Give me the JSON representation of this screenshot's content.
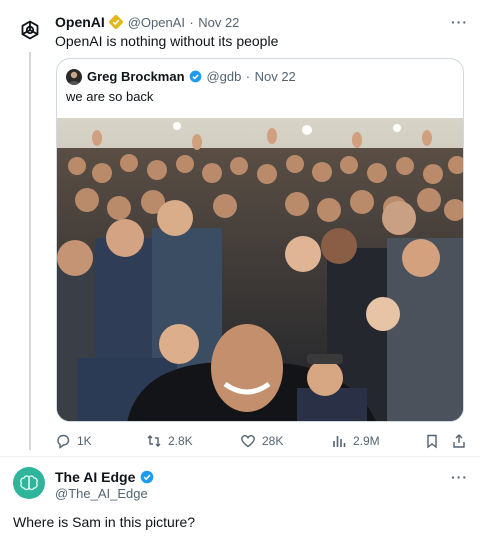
{
  "tweet": {
    "author_name": "OpenAI",
    "author_handle": "@OpenAI",
    "separator": "·",
    "date": "Nov 22",
    "text": "OpenAI is nothing without its people",
    "quote": {
      "author_name": "Greg Brockman",
      "author_handle": "@gdb",
      "date": "Nov 22",
      "text": "we are so back"
    },
    "actions": {
      "replies": "1K",
      "retweets": "2.8K",
      "likes": "28K",
      "views": "2.9M"
    }
  },
  "reply": {
    "author_name": "The AI Edge",
    "author_handle": "@The_AI_Edge",
    "text": "Where is Sam in this picture?"
  },
  "colors": {
    "verified_blue": "#1d9bf0",
    "verified_gold": "#e2b719",
    "muted_text": "#536471",
    "border": "#cfd9de"
  },
  "icons": [
    "openai-logo-icon",
    "verified-gold-icon",
    "verified-blue-icon",
    "more-icon",
    "reply-icon",
    "retweet-icon",
    "like-icon",
    "views-icon",
    "bookmark-icon",
    "share-icon",
    "brain-avatar-icon"
  ]
}
